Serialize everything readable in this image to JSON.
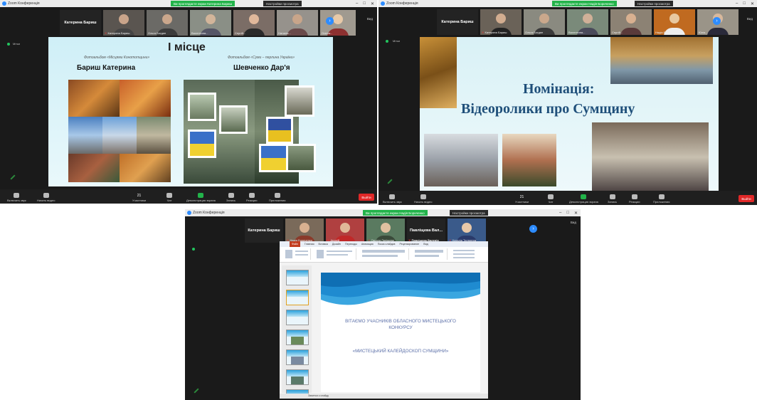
{
  "window1": {
    "title": "Zoom Конференція",
    "banner": "Ви проглядаєте екран Катерина Бариш",
    "view_options": "Настройки просмотра",
    "host_name": "Катерина Бариш",
    "participants": [
      {
        "label": "Катерина Бариш"
      },
      {
        "label": "Ольга Богдан"
      },
      {
        "label": "Валентина..."
      },
      {
        "label": "Сергій..."
      },
      {
        "label": "Наталія..."
      },
      {
        "label": "Олена..."
      }
    ],
    "side_label": "Мітки",
    "view_label": "Вид",
    "slide": {
      "place": "І місце",
      "caption_left": "Фотоальбом «Місцями Конотопщини»",
      "caption_right": "Фотоальбом «Суми – перлина України»",
      "name_left": "Бариш Катерина",
      "name_right": "Шевченко Дар'я"
    },
    "toolbar": {
      "mic": "Включить звук",
      "video": "Начать видео",
      "participants": "Участники",
      "participants_count": "21",
      "chat": "Чат",
      "share": "Демонстрация экрана",
      "record": "Запись",
      "reactions": "Реакции",
      "apps": "Приложения",
      "end": "Выйти"
    }
  },
  "window2": {
    "title": "Zoom Конференція",
    "banner": "Ви проглядаєте екран Надія Бориченко",
    "view_options": "Настройки просмотра",
    "host_name": "Катерина Бариш",
    "participants": [
      {
        "label": "Катерина Бариш"
      },
      {
        "label": "Ольга Богдан"
      },
      {
        "label": "Валентина..."
      },
      {
        "label": "Сергій..."
      },
      {
        "label": "Надія Бориченко"
      },
      {
        "label": "Юлія..."
      }
    ],
    "side_label": "Мітки",
    "view_label": "Вид",
    "slide": {
      "line1": "Номінація:",
      "line2": "Відеоролики про Сумщину"
    },
    "toolbar": {
      "mic": "Включить звук",
      "video": "Начать видео",
      "participants": "Участники",
      "participants_count": "21",
      "chat": "Чат",
      "share": "Демонстрация экрана",
      "record": "Запись",
      "reactions": "Реакции",
      "apps": "Приложения",
      "end": "Выйти"
    }
  },
  "window3": {
    "title": "Zoom Конференція",
    "banner": "Ви проглядаєте екран Надія Бориченко",
    "view_options": "Настройки просмотра",
    "host_name": "Катерина Бариш",
    "right_name": "Павліщева Вал...",
    "participants": [
      {
        "label": "Надія Бориченко"
      },
      {
        "label": "Андрій"
      },
      {
        "label": "Оксана Ляпіщева"
      },
      {
        "label": "Павліщева Валерія"
      },
      {
        "label": "Наталія Тютюнник"
      }
    ],
    "view_label": "Вид",
    "ppt": {
      "tabs": [
        "Файл",
        "Главная",
        "Вставка",
        "Дизайн",
        "Переходы",
        "Анимация",
        "Показ слайдов",
        "Рецензирование",
        "Вид"
      ],
      "thumb_numbers": [
        "1",
        "2",
        "3",
        "4",
        "5",
        "6",
        "7"
      ],
      "line1": "ВІТАЄМО УЧАСНИКІВ ОБЛАСНОГО МИСТЕЦЬКОГО",
      "line2": "КОНКУРСУ",
      "line3": "«МИСТЕЦЬКИЙ КАЛЕЙДОСКОП СУМЩИНИ»",
      "notes": "Заметки к слайду"
    }
  },
  "colors": {
    "zoom_blue": "#2d8cff",
    "share_green": "#22b34a",
    "end_red": "#e02828",
    "slide_title_blue": "#1f4f7a"
  }
}
